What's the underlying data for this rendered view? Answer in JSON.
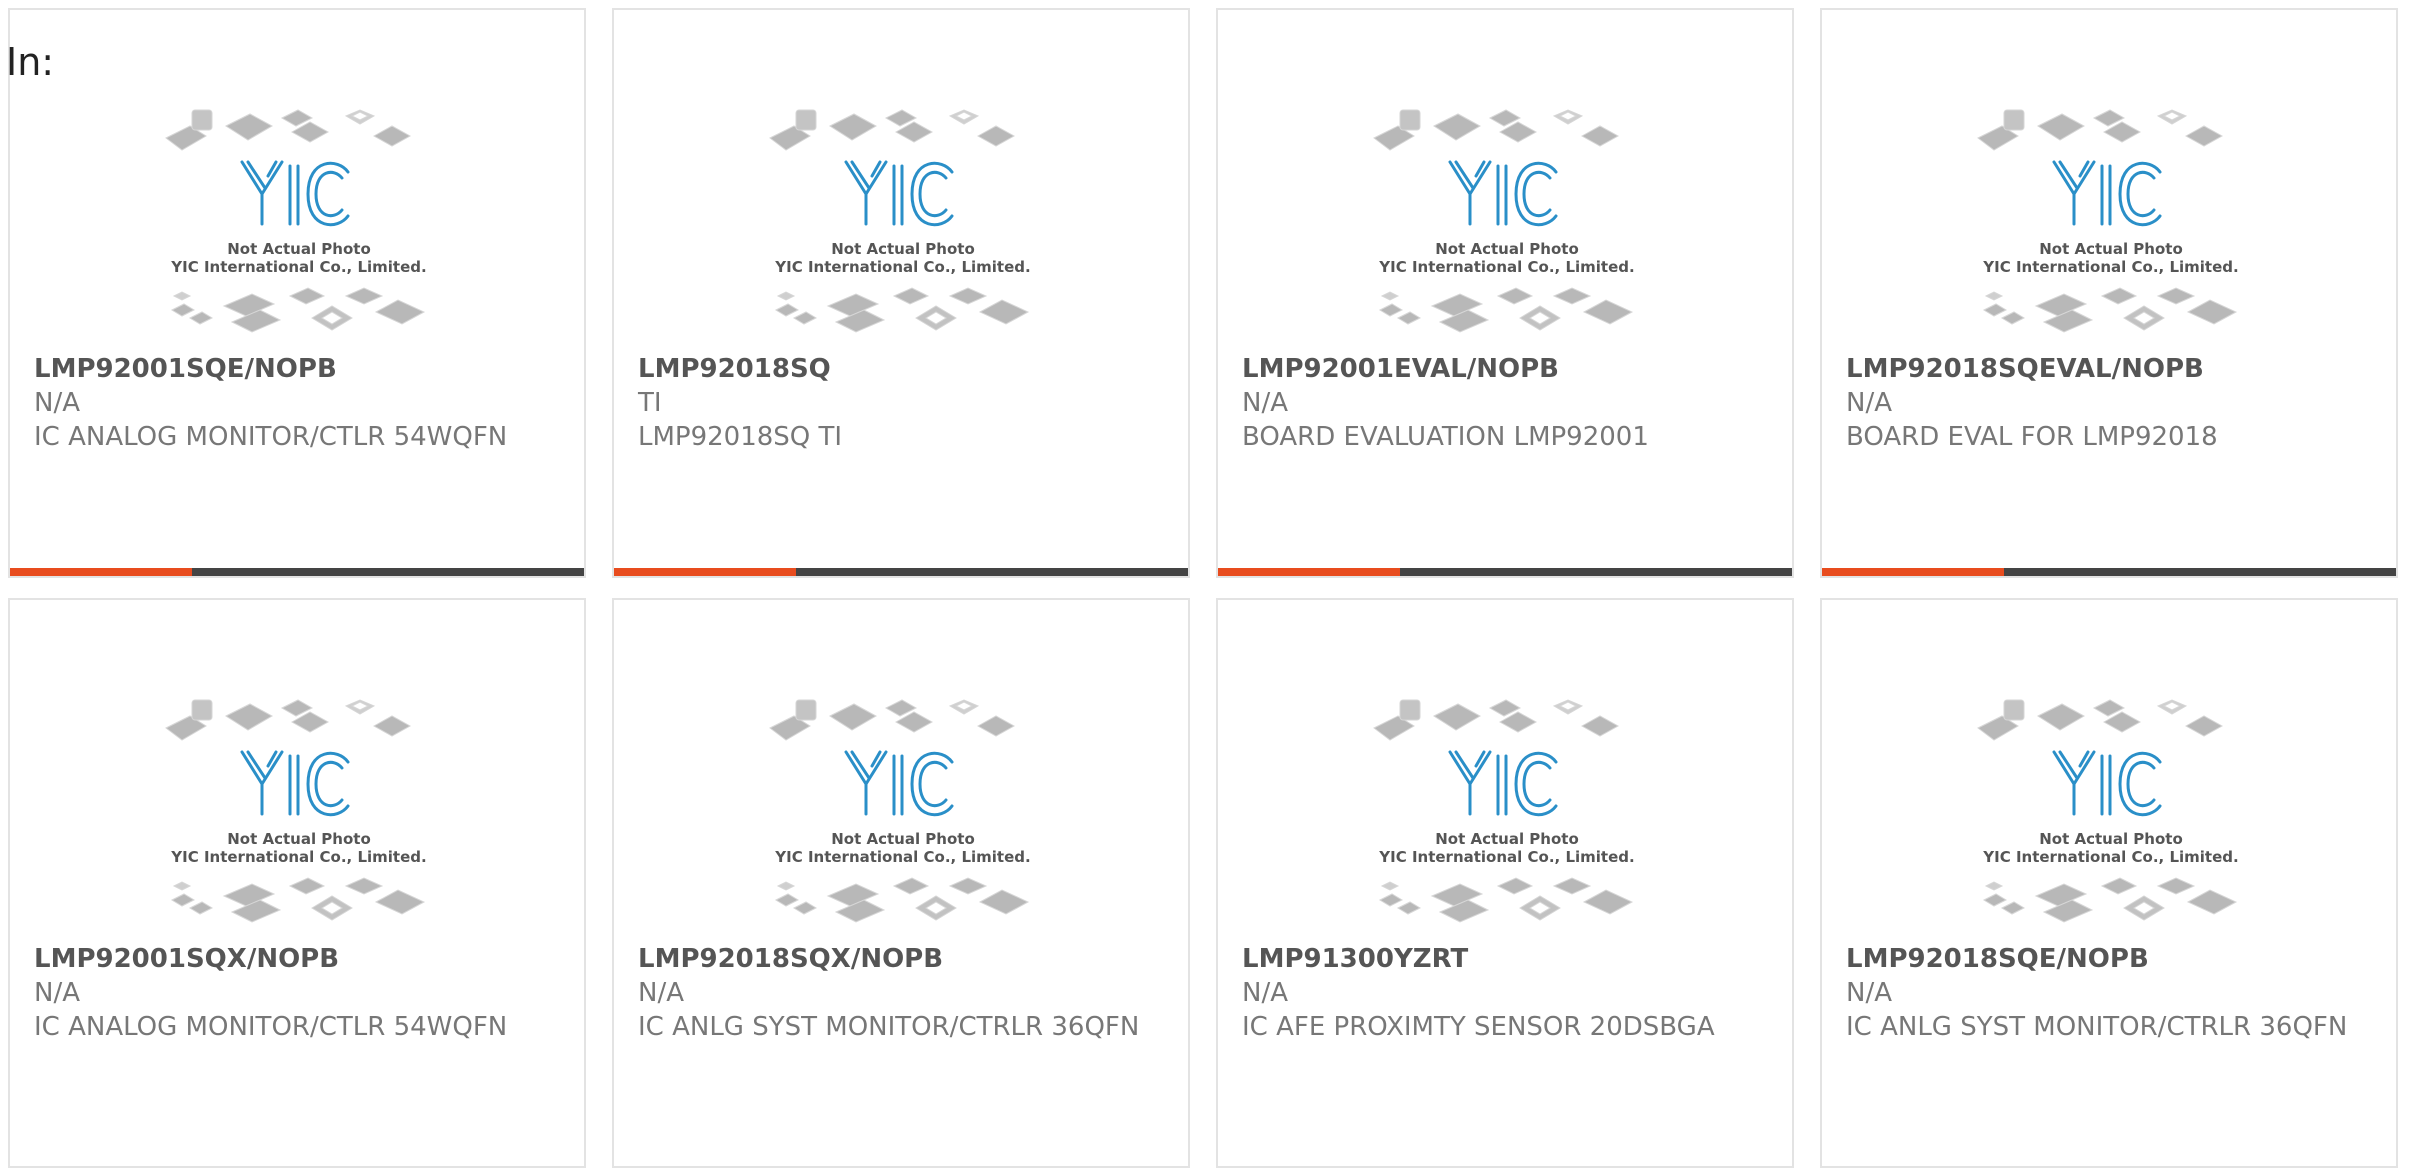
{
  "page": {
    "label": "In:"
  },
  "photo": {
    "brand": "YIC",
    "caption_line1": "Not Actual Photo",
    "caption_line2": "YIC International Co., Limited."
  },
  "colors": {
    "accent": "#e84c1e",
    "bar": "#444444",
    "brand_blue": "#2a8fc8",
    "card_border": "#e3e3e3"
  },
  "products": [
    {
      "part_no": "LMP92001SQE/NOPB",
      "manufacturer": "N/A",
      "description": "IC ANALOG MONITOR/CTLR 54WQFN"
    },
    {
      "part_no": "LMP92018SQ",
      "manufacturer": "TI",
      "description": "LMP92018SQ TI"
    },
    {
      "part_no": "LMP92001EVAL/NOPB",
      "manufacturer": "N/A",
      "description": "BOARD EVALUATION LMP92001"
    },
    {
      "part_no": "LMP92018SQEVAL/NOPB",
      "manufacturer": "N/A",
      "description": "BOARD EVAL FOR LMP92018"
    },
    {
      "part_no": "LMP92001SQX/NOPB",
      "manufacturer": "N/A",
      "description": "IC ANALOG MONITOR/CTLR 54WQFN"
    },
    {
      "part_no": "LMP92018SQX/NOPB",
      "manufacturer": "N/A",
      "description": "IC ANLG SYST MONITOR/CTRLR 36QFN"
    },
    {
      "part_no": "LMP91300YZRT",
      "manufacturer": "N/A",
      "description": "IC AFE PROXIMTY SENSOR 20DSBGA"
    },
    {
      "part_no": "LMP92018SQE/NOPB",
      "manufacturer": "N/A",
      "description": "IC ANLG SYST MONITOR/CTRLR 36QFN"
    }
  ]
}
